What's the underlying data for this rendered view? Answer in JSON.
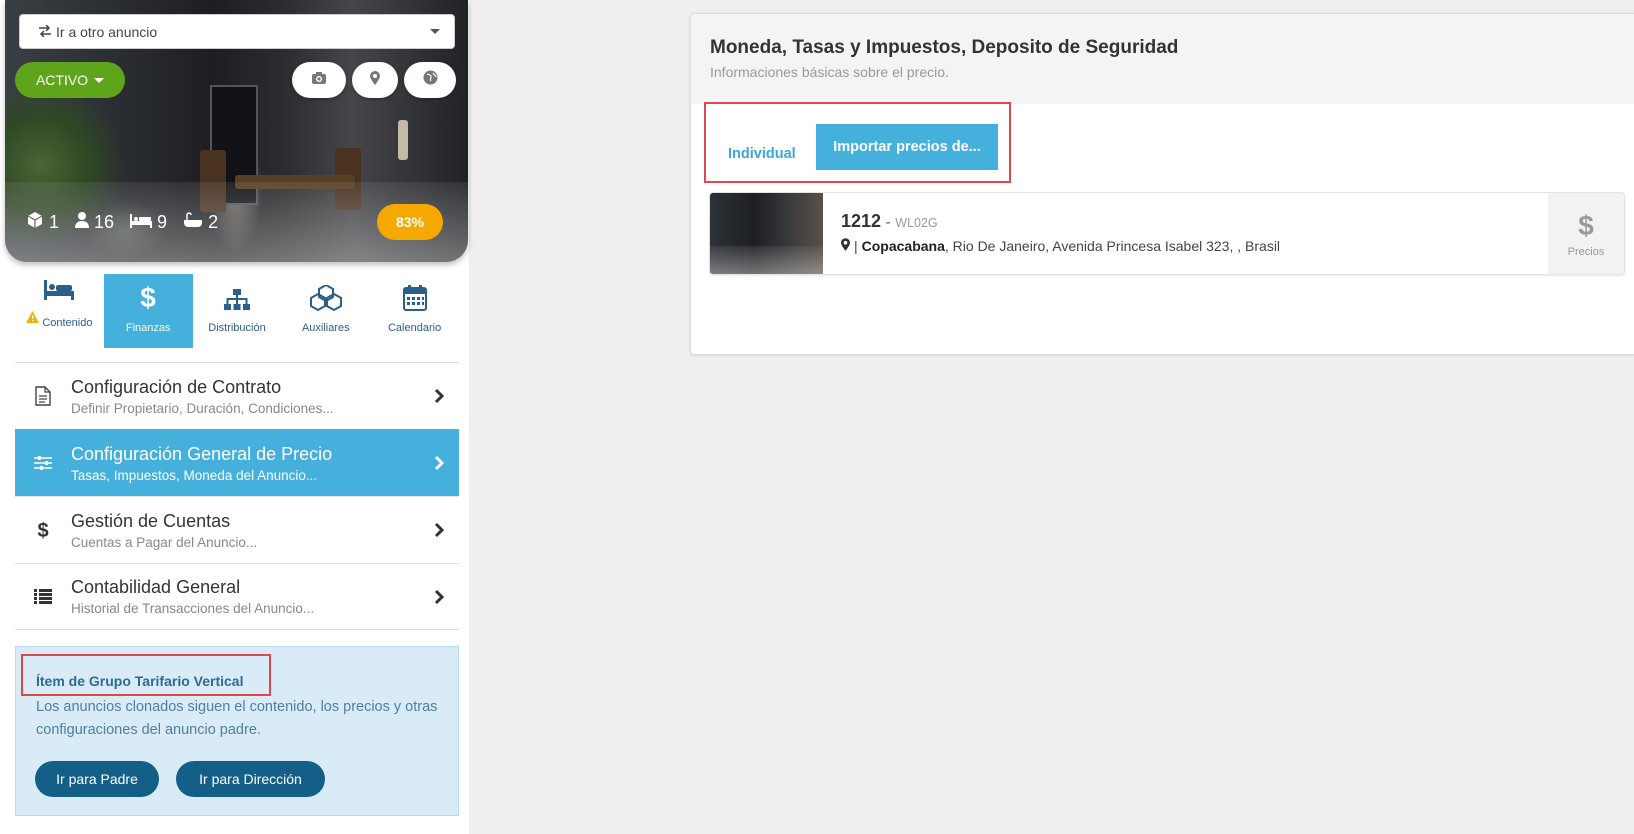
{
  "listing_selector": {
    "label": "Ir a otro anuncio"
  },
  "hero": {
    "status": "ACTIVO",
    "icons": [
      "camera-icon",
      "map-pin-icon",
      "globe-icon"
    ],
    "stats": {
      "units": "1",
      "guests": "16",
      "beds": "9",
      "baths": "2"
    },
    "completion": "83%"
  },
  "tabs": [
    {
      "label": "Contenido",
      "icon": "bed-icon",
      "warning": true
    },
    {
      "label": "Finanzas",
      "icon": "dollar-icon",
      "active": true
    },
    {
      "label": "Distribución",
      "icon": "sitemap-icon"
    },
    {
      "label": "Auxiliares",
      "icon": "cubes-icon"
    },
    {
      "label": "Calendario",
      "icon": "calendar-icon"
    }
  ],
  "menu": [
    {
      "title": "Configuración de Contrato",
      "subtitle": "Definir Propietario, Duración, Condiciones..."
    },
    {
      "title": "Configuración General de Precio",
      "subtitle": "Tasas, Impuestos, Moneda del Anuncio...",
      "active": true
    },
    {
      "title": "Gestión de Cuentas",
      "subtitle": "Cuentas a Pagar del Anuncio..."
    },
    {
      "title": "Contabilidad General",
      "subtitle": "Historial de Transacciones del Anuncio..."
    }
  ],
  "group": {
    "title": "Ítem de Grupo Tarifario Vertical",
    "description": "Los anuncios clonados siguen el contenido, los precios y otras configuraciones del anuncio padre.",
    "btn_parent": "Ir para Padre",
    "btn_address": "Ir para Dirección"
  },
  "main": {
    "title": "Moneda, Tasas y Impuestos, Deposito de Seguridad",
    "subtitle": "Informaciones básicas sobre el precio.",
    "toggle_individual": "Individual",
    "toggle_import": "Importar precios de...",
    "listing": {
      "code": "1212",
      "separator": "-",
      "ref": "WL02G",
      "neighborhood": "Copacabana",
      "address_rest": ", Rio De Janeiro, Avenida Princesa Isabel 323, , Brasil",
      "pipe": "|",
      "price_symbol": "$",
      "price_label": "Precios"
    }
  },
  "colors": {
    "accent": "#44b0db",
    "active_green": "#5ea51c",
    "percent": "#f5a800",
    "group_btn": "#145f87",
    "highlight": "#e0474c"
  }
}
